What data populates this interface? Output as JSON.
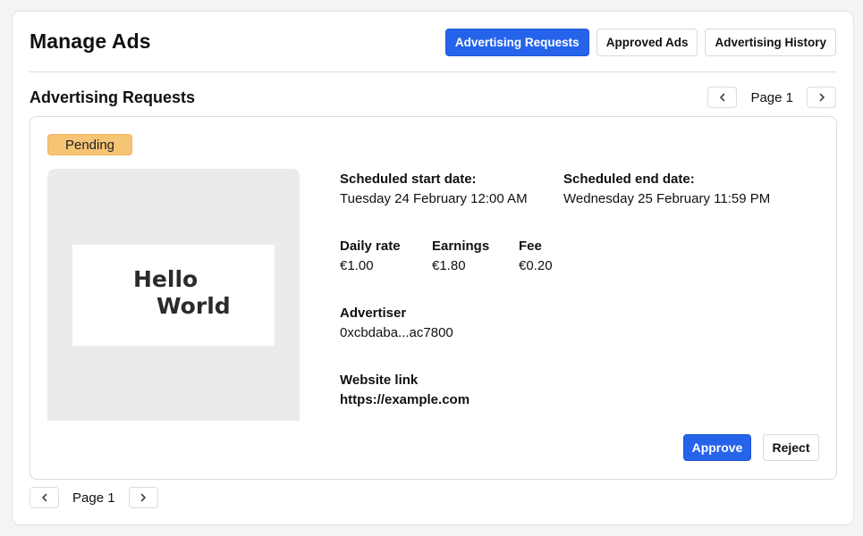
{
  "header": {
    "title": "Manage Ads",
    "tabs": [
      {
        "label": "Advertising Requests",
        "active": true
      },
      {
        "label": "Approved Ads",
        "active": false
      },
      {
        "label": "Advertising History",
        "active": false
      }
    ]
  },
  "section": {
    "title": "Advertising Requests",
    "pager_label": "Page 1"
  },
  "request": {
    "status": "Pending",
    "preview": {
      "line1": "Hello",
      "line2": "World"
    },
    "start": {
      "label": "Scheduled start date:",
      "value": "Tuesday 24 February 12:00 AM"
    },
    "end": {
      "label": "Scheduled end date:",
      "value": "Wednesday 25 February 11:59 PM"
    },
    "daily_rate": {
      "label": "Daily rate",
      "value": "€1.00"
    },
    "earnings": {
      "label": "Earnings",
      "value": "€1.80"
    },
    "fee": {
      "label": "Fee",
      "value": "€0.20"
    },
    "advertiser": {
      "label": "Advertiser",
      "value": "0xcbdaba...ac7800"
    },
    "website": {
      "label": "Website link",
      "value": "https://example.com"
    },
    "approve_label": "Approve",
    "reject_label": "Reject"
  },
  "footer": {
    "pager_label": "Page 1"
  },
  "colors": {
    "accent": "#2563eb",
    "pending": "#f6c475",
    "preview_bg": "#ebebeb"
  },
  "icons": {
    "prev": "chevron-left-icon",
    "next": "chevron-right-icon"
  }
}
